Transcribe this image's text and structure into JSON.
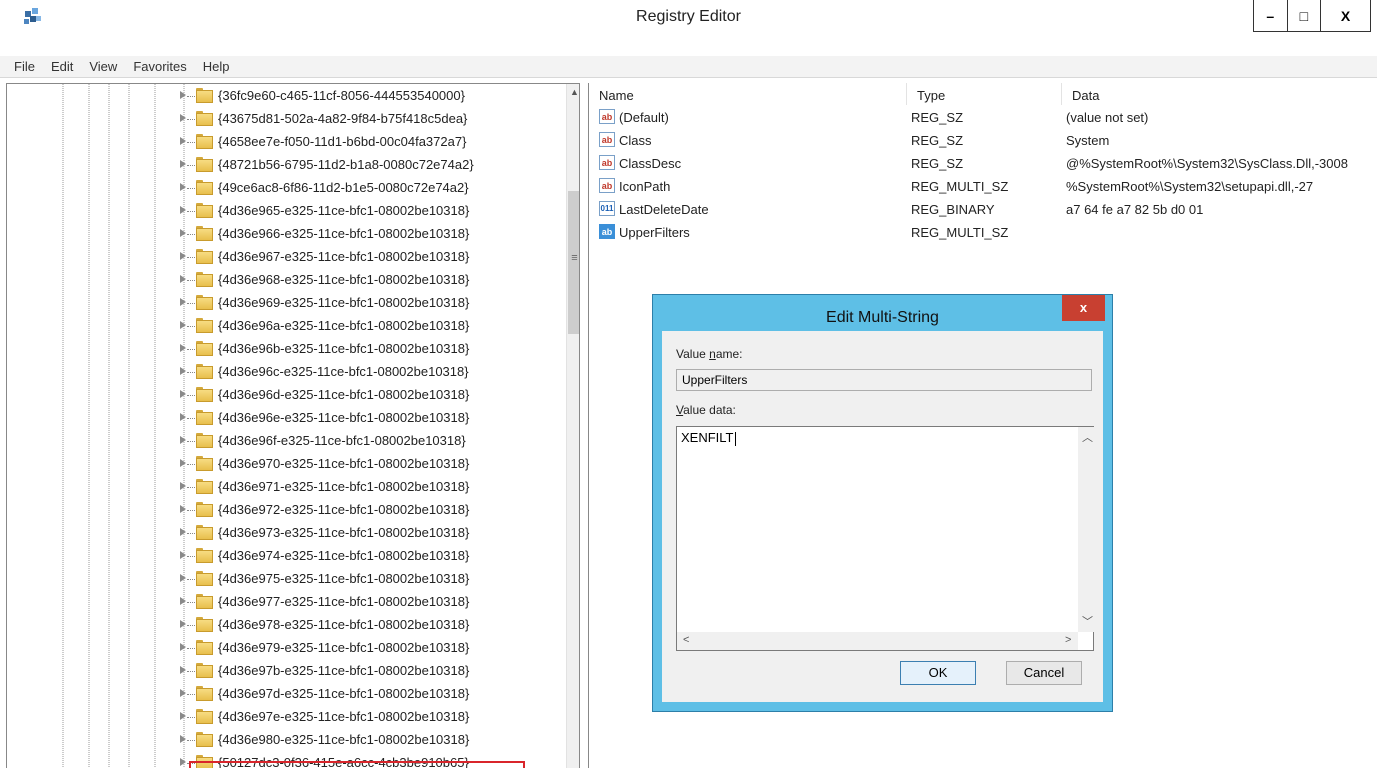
{
  "window": {
    "title": "Registry Editor",
    "controls": {
      "minimize": "–",
      "maximize": "□",
      "close": "X"
    }
  },
  "menu": [
    "File",
    "Edit",
    "View",
    "Favorites",
    "Help"
  ],
  "tree": {
    "items": [
      "{36fc9e60-c465-11cf-8056-444553540000}",
      "{43675d81-502a-4a82-9f84-b75f418c5dea}",
      "{4658ee7e-f050-11d1-b6bd-00c04fa372a7}",
      "{48721b56-6795-11d2-b1a8-0080c72e74a2}",
      "{49ce6ac8-6f86-11d2-b1e5-0080c72e74a2}",
      "{4d36e965-e325-11ce-bfc1-08002be10318}",
      "{4d36e966-e325-11ce-bfc1-08002be10318}",
      "{4d36e967-e325-11ce-bfc1-08002be10318}",
      "{4d36e968-e325-11ce-bfc1-08002be10318}",
      "{4d36e969-e325-11ce-bfc1-08002be10318}",
      "{4d36e96a-e325-11ce-bfc1-08002be10318}",
      "{4d36e96b-e325-11ce-bfc1-08002be10318}",
      "{4d36e96c-e325-11ce-bfc1-08002be10318}",
      "{4d36e96d-e325-11ce-bfc1-08002be10318}",
      "{4d36e96e-e325-11ce-bfc1-08002be10318}",
      "{4d36e96f-e325-11ce-bfc1-08002be10318}",
      "{4d36e970-e325-11ce-bfc1-08002be10318}",
      "{4d36e971-e325-11ce-bfc1-08002be10318}",
      "{4d36e972-e325-11ce-bfc1-08002be10318}",
      "{4d36e973-e325-11ce-bfc1-08002be10318}",
      "{4d36e974-e325-11ce-bfc1-08002be10318}",
      "{4d36e975-e325-11ce-bfc1-08002be10318}",
      "{4d36e977-e325-11ce-bfc1-08002be10318}",
      "{4d36e978-e325-11ce-bfc1-08002be10318}",
      "{4d36e979-e325-11ce-bfc1-08002be10318}",
      "{4d36e97b-e325-11ce-bfc1-08002be10318}",
      "{4d36e97d-e325-11ce-bfc1-08002be10318}",
      "{4d36e97e-e325-11ce-bfc1-08002be10318}",
      "{4d36e980-e325-11ce-bfc1-08002be10318}",
      "{50127dc3-0f36-415e-a6cc-4cb3be910b65}"
    ],
    "highlighted_index": 26
  },
  "values": {
    "columns": [
      "Name",
      "Type",
      "Data"
    ],
    "rows": [
      {
        "icon": "string-value-icon",
        "name": "(Default)",
        "type": "REG_SZ",
        "data": "(value not set)"
      },
      {
        "icon": "string-value-icon",
        "name": "Class",
        "type": "REG_SZ",
        "data": "System"
      },
      {
        "icon": "string-value-icon",
        "name": "ClassDesc",
        "type": "REG_SZ",
        "data": "@%SystemRoot%\\System32\\SysClass.Dll,-3008"
      },
      {
        "icon": "string-value-icon",
        "name": "IconPath",
        "type": "REG_MULTI_SZ",
        "data": "%SystemRoot%\\System32\\setupapi.dll,-27"
      },
      {
        "icon": "binary-value-icon",
        "name": "LastDeleteDate",
        "type": "REG_BINARY",
        "data": "a7 64 fe a7 82 5b d0 01"
      },
      {
        "icon": "string-value-icon",
        "name": "UpperFilters",
        "type": "REG_MULTI_SZ",
        "data": ""
      }
    ]
  },
  "dialog": {
    "title": "Edit Multi-String",
    "close": "x",
    "value_name_label_pre": "Value ",
    "value_name_label_key": "n",
    "value_name_label_post": "ame:",
    "value_name": "UpperFilters",
    "value_data_label_key": "V",
    "value_data_label_post": "alue data:",
    "value_data": "XENFILT",
    "ok": "OK",
    "cancel": "Cancel"
  }
}
